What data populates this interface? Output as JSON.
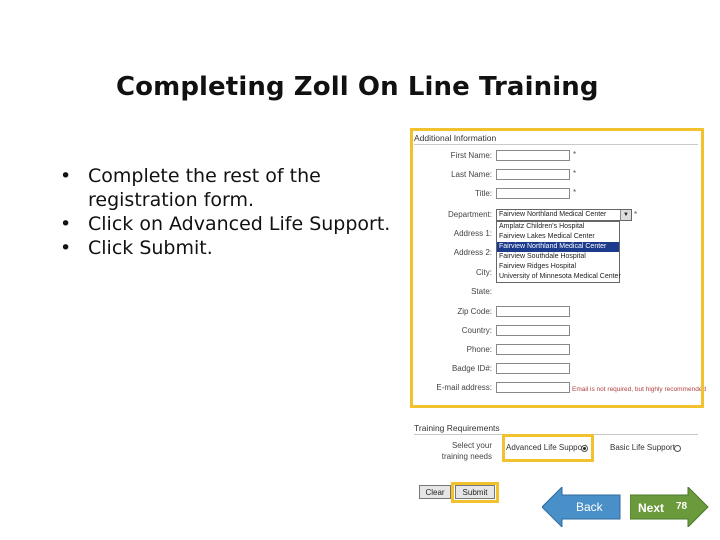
{
  "slide": {
    "title": "Completing Zoll On Line Training",
    "bullets": [
      "Complete the rest of the registration form.",
      "Click on Advanced Life Support.",
      "Click Submit."
    ]
  },
  "form": {
    "section_title": "Additional Information",
    "fields": [
      {
        "label": "First Name:"
      },
      {
        "label": "Last Name:"
      },
      {
        "label": "Title:"
      },
      {
        "label": "Department:"
      },
      {
        "label": "Address 1:"
      },
      {
        "label": "Address 2:"
      },
      {
        "label": "City:"
      },
      {
        "label": "State:"
      },
      {
        "label": "Zip Code:"
      },
      {
        "label": "Country:"
      },
      {
        "label": "Phone:"
      },
      {
        "label": "Badge ID#:"
      },
      {
        "label": "E-mail address:"
      }
    ],
    "department_selected": "Fairview Northland Medical Center",
    "department_options": [
      "Amplatz Children's Hospital",
      "Fairview Lakes Medical Center",
      "Fairview Northland Medical Center",
      "Fairview Southdale Hospital",
      "Fairview Ridges Hospital",
      "University of Minnesota Medical Center"
    ],
    "email_note": "Email is not required, but highly recommended"
  },
  "training": {
    "section_title": "Training Requirements",
    "prompt": "Select your training needs",
    "options": [
      "Advanced Life Support",
      "Basic Life Support"
    ]
  },
  "buttons": {
    "clear": "Clear",
    "submit": "Submit"
  },
  "nav": {
    "back": "Back",
    "next": "Next",
    "page_number": "78"
  },
  "colors": {
    "highlight": "#f2c12e",
    "back_button": "#4a90c8",
    "next_button": "#6a9a3c",
    "selected_option": "#1c3b8c"
  }
}
